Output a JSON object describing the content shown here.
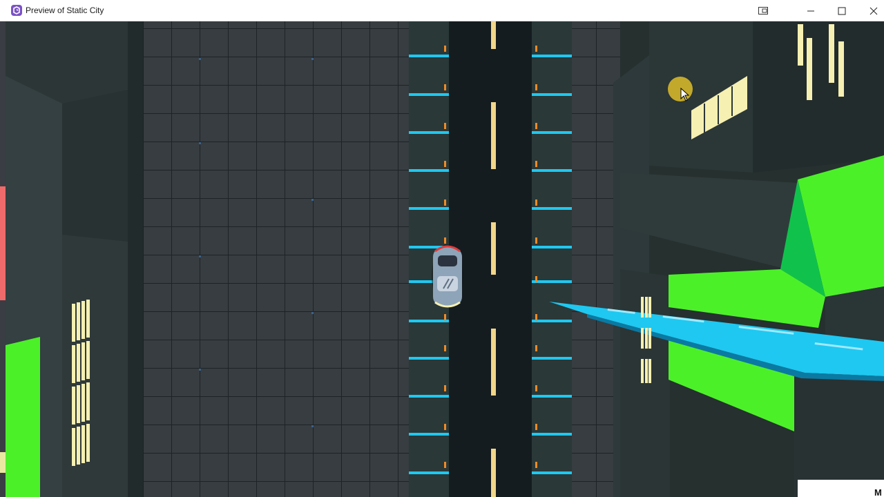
{
  "window": {
    "title": "Preview of Static City",
    "app_icon": "gamemaker-icon",
    "controls": [
      "snap-layout-icon",
      "minimize-icon",
      "maximize-icon",
      "close-icon"
    ]
  },
  "scene": {
    "name": "Static City",
    "player": "car",
    "colors": {
      "background": "#26302f",
      "tile": "#373d41",
      "tile_line": "#1c2225",
      "road": "#151c20",
      "lane_marking": "#f2d68a",
      "neon_blue": "#1fc8f0",
      "neon_green": "#4cf029",
      "window_light": "#f6f0b2",
      "building": "#2f3b3c"
    }
  },
  "overlay": {
    "corner_text": "M"
  }
}
